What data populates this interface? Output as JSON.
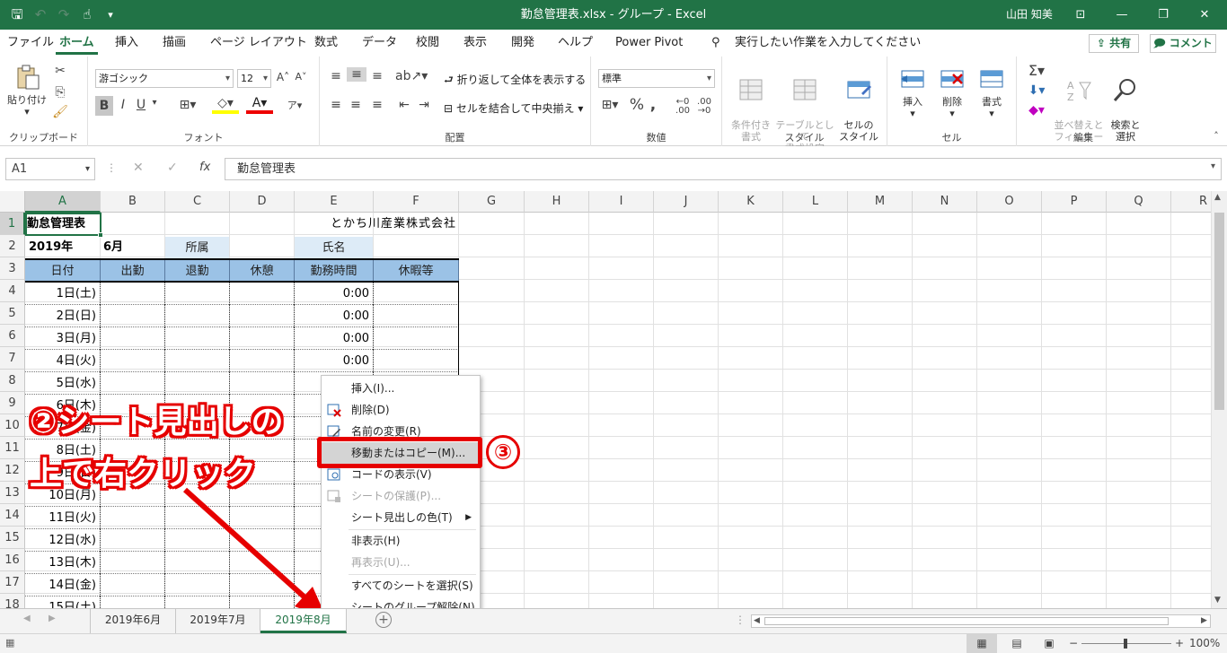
{
  "titlebar": {
    "title": "勤怠管理表.xlsx  -  グループ  -  Excel",
    "user": "山田 知美",
    "window_buttons": [
      "⊡",
      "—",
      "❐",
      "✕"
    ]
  },
  "menu": {
    "tabs": [
      "ファイル",
      "ホーム",
      "挿入",
      "描画",
      "ページ レイアウト",
      "数式",
      "データ",
      "校閲",
      "表示",
      "開発",
      "ヘルプ",
      "Power Pivot"
    ],
    "tell_me": "実行したい作業を入力してください",
    "share": "共有",
    "comment": "コメント"
  },
  "ribbon": {
    "clipboard": {
      "paste": "貼り付け",
      "label": "クリップボード"
    },
    "font": {
      "name": "游ゴシック",
      "size": "12",
      "label": "フォント",
      "bold": "B",
      "italic": "I",
      "underline": "U"
    },
    "alignment": {
      "wrap": "折り返して全体を表示する",
      "merge": "セルを結合して中央揃え",
      "label": "配置"
    },
    "number": {
      "format": "標準",
      "label": "数値"
    },
    "styles": {
      "cond": "条件付き\n書式",
      "table": "テーブルとして\n書式設定",
      "cell": "セルの\nスタイル",
      "label": "スタイル"
    },
    "cells": {
      "insert": "挿入",
      "delete": "削除",
      "format": "書式",
      "label": "セル"
    },
    "editing": {
      "sort": "並べ替えと\nフィルター",
      "find": "検索と\n選択",
      "label": "編集"
    }
  },
  "formula_bar": {
    "name_box": "A1",
    "fx": "fx",
    "content": "勤怠管理表"
  },
  "grid": {
    "columns": [
      "A",
      "B",
      "C",
      "D",
      "E",
      "F",
      "G",
      "H",
      "I",
      "J",
      "K",
      "L",
      "M",
      "N",
      "O",
      "P",
      "Q",
      "R"
    ],
    "rows": [
      "1",
      "2",
      "3",
      "4",
      "5",
      "6",
      "7",
      "8",
      "9",
      "10",
      "11",
      "12",
      "13",
      "14",
      "15",
      "16",
      "17",
      "18"
    ],
    "cells": {
      "A1": "勤怠管理表",
      "E1": "とかち川産業株式会社",
      "A2": "2019年",
      "B2": "6月",
      "C2": "所属",
      "E2": "氏名",
      "headers": [
        "日付",
        "出勤",
        "退勤",
        "休憩",
        "勤務時間",
        "休暇等"
      ],
      "dates": [
        "1日(土)",
        "2日(日)",
        "3日(月)",
        "4日(火)",
        "5日(水)",
        "6日(木)",
        "7日(金)",
        "8日(土)",
        "9日(日)",
        "10日(月)",
        "11日(火)",
        "12日(水)",
        "13日(木)",
        "14日(金)",
        "15日(土)"
      ],
      "hours": [
        "0:00",
        "0:00",
        "0:00",
        "0:00"
      ]
    }
  },
  "context_menu": {
    "items": [
      {
        "label": "挿入(I)...",
        "disabled": false
      },
      {
        "label": "削除(D)",
        "disabled": false
      },
      {
        "label": "名前の変更(R)",
        "disabled": false
      },
      {
        "label": "移動またはコピー(M)...",
        "disabled": false
      },
      {
        "label": "コードの表示(V)",
        "disabled": false
      },
      {
        "label": "シートの保護(P)...",
        "disabled": true
      },
      {
        "label": "シート見出しの色(T)",
        "disabled": false
      },
      {
        "label": "非表示(H)",
        "disabled": false
      },
      {
        "label": "再表示(U)...",
        "disabled": true
      },
      {
        "label": "すべてのシートを選択(S)",
        "disabled": false
      },
      {
        "label": "シートのグループ解除(N)",
        "disabled": false
      }
    ]
  },
  "annotation": {
    "line1": "②シート見出しの",
    "line2": "上で右クリック",
    "step3": "③"
  },
  "sheets": [
    "2019年6月",
    "2019年7月",
    "2019年8月"
  ],
  "status": {
    "zoom": "100%"
  },
  "colors": {
    "excel_green": "#217346",
    "header_blue": "#9bc2e6",
    "label_blue": "#ddebf7",
    "annotation_red": "#e60000"
  }
}
